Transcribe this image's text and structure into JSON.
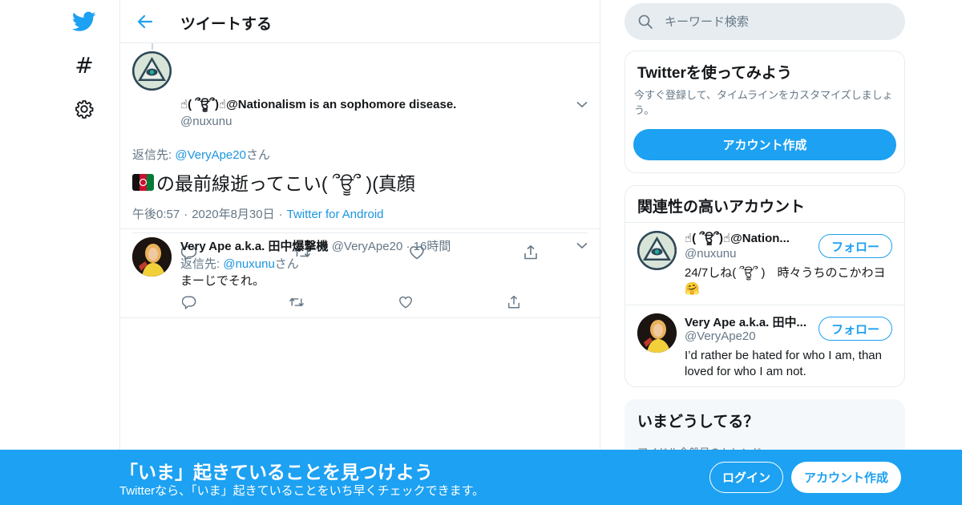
{
  "header": {
    "title": "ツイートする"
  },
  "search": {
    "placeholder": "キーワード検索"
  },
  "tweet": {
    "author_name": "☝( ՞ਊ՞)☝@Nationalism is an sophomore disease.",
    "author_handle": "@nuxunu",
    "reply_to_prefix": "返信先: ",
    "reply_to_handle": "@VeryApe20",
    "reply_to_suffix": "さん",
    "text": "の最前線逝ってこい( ՞ਊ՞ )(真顔",
    "time": "午後0:57",
    "date": "2020年8月30日",
    "source": "Twitter for Android"
  },
  "reply": {
    "author_name": "Very Ape a.k.a. 田中爆撃機",
    "author_handle": "@VeryApe20",
    "time_ago": "16時間",
    "reply_to_prefix": "返信先: ",
    "reply_to_handle": "@nuxunu",
    "reply_to_suffix": "さん",
    "text": "まーじでそれ。"
  },
  "try_card": {
    "title": "Twitterを使ってみよう",
    "description": "今すぐ登録して、タイムラインをカスタマイズしましょう。",
    "button": "アカウント作成"
  },
  "related": {
    "title": "関連性の高いアカウント",
    "accounts": [
      {
        "name": "☝( ՞ਊ՞)☝@Nation...",
        "handle": "@nuxunu",
        "bio": "24/7しね( ՞ਊ՞ )　時々うちのこかわヨ🤗",
        "button": "フォロー"
      },
      {
        "name": "Very Ape a.k.a. 田中...",
        "handle": "@VeryApe20",
        "bio": "I’d rather be hated for who I am, than loved for who I am not.",
        "button": "フォロー"
      }
    ]
  },
  "trends": {
    "title": "いまどうしてる？",
    "first_item": "アイドル全般日のトレンド"
  },
  "banner": {
    "title": "「いま」起きていることを見つけよう",
    "subtitle": "Twitterなら、「いま」起きていることをいち早くチェックできます。",
    "login": "ログイン",
    "signup": "アカウント作成"
  },
  "colors": {
    "accent": "#1da1f2",
    "link": "#1b95e0",
    "muted": "#657786",
    "border": "#e6ecf0"
  }
}
